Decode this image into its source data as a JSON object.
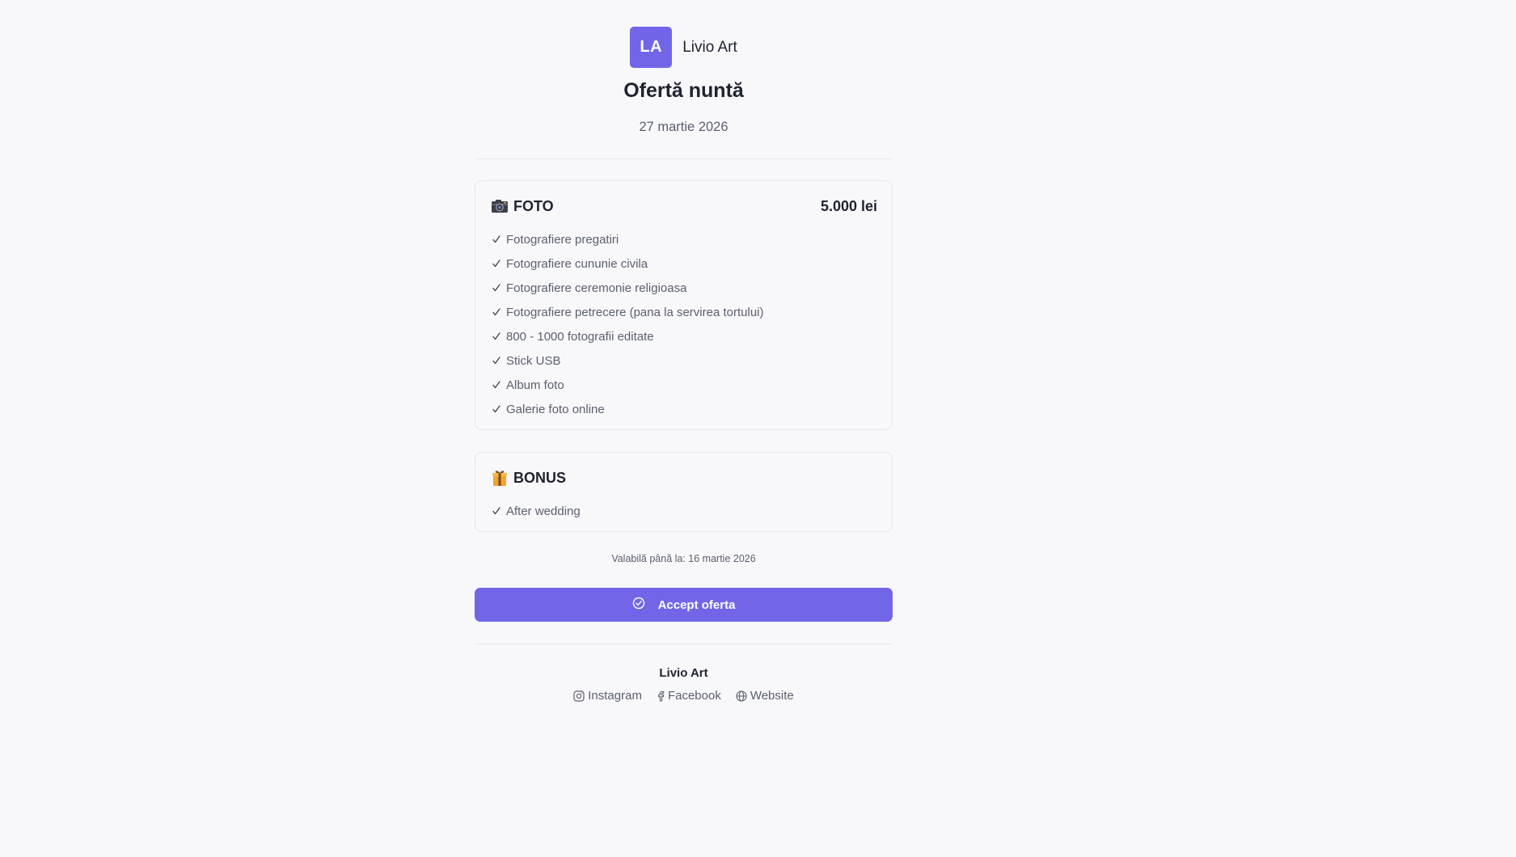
{
  "brand": {
    "initials": "LA",
    "name": "Livio Art"
  },
  "offer": {
    "title": "Ofertă nuntă",
    "date": "27 martie 2026"
  },
  "sections": [
    {
      "icon": "camera-icon",
      "title": "FOTO",
      "price": "5.000 lei",
      "items": [
        "Fotografiere pregatiri",
        "Fotografiere cununie civila",
        "Fotografiere ceremonie religioasa",
        "Fotografiere petrecere (pana la servirea tortului)",
        "800 - 1000 fotografii editate",
        "Stick USB",
        "Album foto",
        "Galerie foto online"
      ]
    },
    {
      "icon": "gift-icon",
      "title": "BONUS",
      "items": [
        "After wedding"
      ]
    }
  ],
  "validity": "Valabilă până la: 16 martie 2026",
  "accept_button": {
    "label": "Accept oferta",
    "icon": "check-circle-icon"
  },
  "footer": {
    "name": "Livio Art",
    "links": [
      {
        "icon": "instagram-icon",
        "label": "Instagram"
      },
      {
        "icon": "facebook-icon",
        "label": "Facebook"
      },
      {
        "icon": "globe-icon",
        "label": "Website"
      }
    ]
  },
  "colors": {
    "accent": "#7166e8",
    "background": "#f8f8fa",
    "text": "#1f2330",
    "muted": "#5b6070",
    "border": "#e6e6ec"
  }
}
